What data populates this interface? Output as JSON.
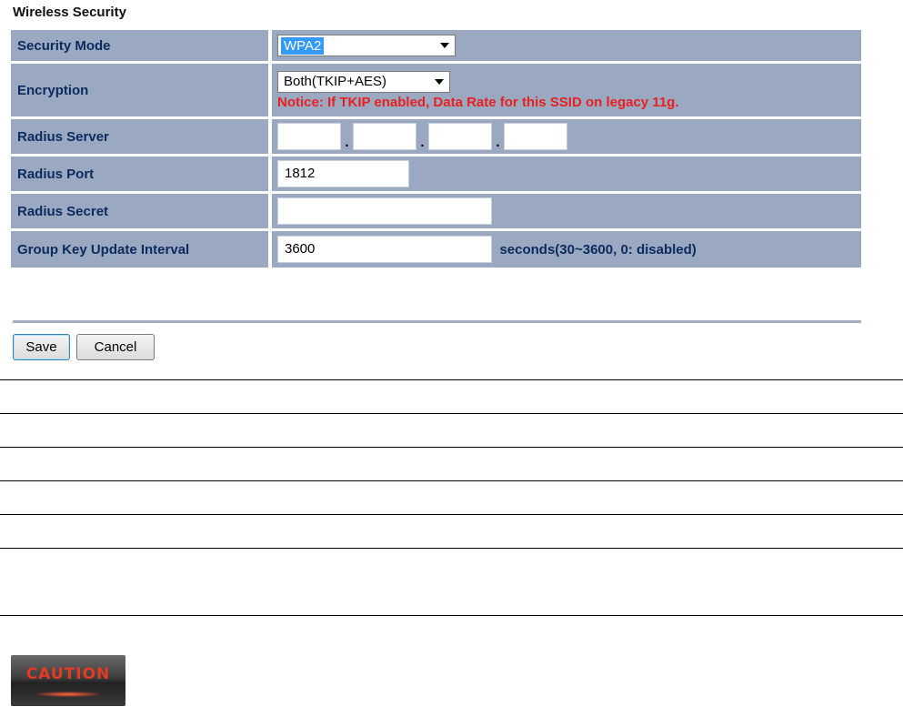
{
  "section_title": "Wireless Security",
  "fields": {
    "security_mode": {
      "label": "Security Mode",
      "value": "WPA2"
    },
    "encryption": {
      "label": "Encryption",
      "value": "Both(TKIP+AES)",
      "notice": "Notice: If TKIP enabled, Data Rate for this SSID on legacy 11g."
    },
    "radius_server": {
      "label": "Radius Server",
      "octets": [
        "",
        "",
        "",
        ""
      ],
      "separator": "."
    },
    "radius_port": {
      "label": "Radius Port",
      "value": "1812"
    },
    "radius_secret": {
      "label": "Radius Secret",
      "value": ""
    },
    "group_key_update_interval": {
      "label": "Group Key Update Interval",
      "value": "3600",
      "hint": "seconds(30~3600, 0: disabled)"
    }
  },
  "buttons": {
    "save": "Save",
    "cancel": "Cancel"
  },
  "caution_badge": {
    "text": "CAUTION"
  },
  "colors": {
    "row_background": "#9aa8c2",
    "label_text": "#0b2a5e",
    "notice_text": "#e8201f",
    "selection_highlight": "#3399ff"
  }
}
